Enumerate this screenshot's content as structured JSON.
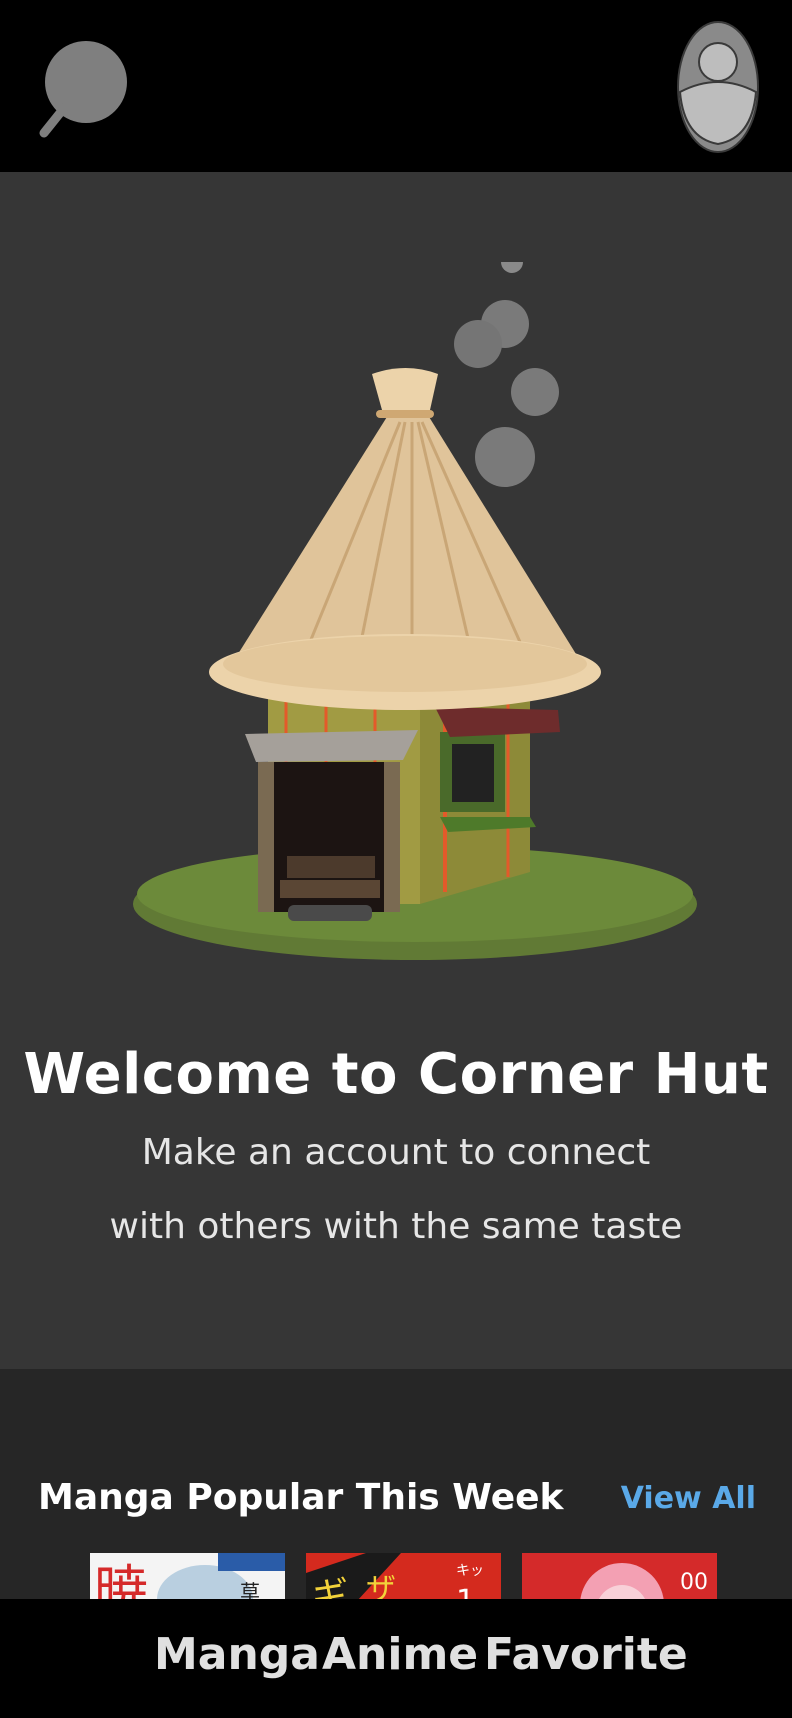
{
  "header": {
    "search_icon": "search-icon",
    "profile_icon": "profile-icon"
  },
  "hero": {
    "illustration": "hut-illustration",
    "title": "Welcome to Corner Hut",
    "subtitle_line1": "Make an account to connect",
    "subtitle_line2": "with others with the same taste"
  },
  "popular": {
    "title": "Manga Popular This Week",
    "view_all_label": "View All",
    "accent_color": "#5aa9e8",
    "covers": [
      {
        "name": "manga-cover-1"
      },
      {
        "name": "manga-cover-2"
      },
      {
        "name": "manga-cover-3"
      }
    ]
  },
  "bottom_nav": {
    "items": [
      {
        "label": "Manga"
      },
      {
        "label": "Anime"
      },
      {
        "label": "Favorite"
      }
    ]
  }
}
